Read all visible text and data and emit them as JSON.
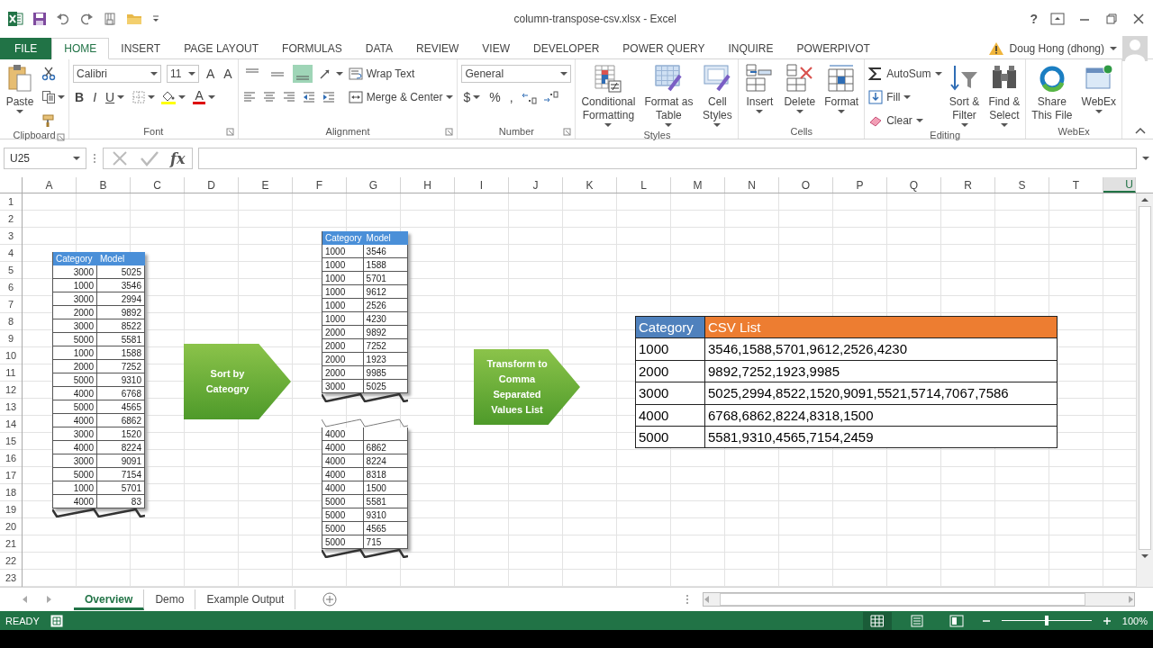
{
  "title_bar": {
    "title": "column-transpose-csv.xlsx - Excel",
    "help": "?"
  },
  "menu_tabs": [
    {
      "label": "FILE",
      "kind": "file",
      "selected": false
    },
    {
      "label": "HOME",
      "kind": "tab",
      "selected": true
    },
    {
      "label": "INSERT",
      "kind": "tab",
      "selected": false
    },
    {
      "label": "PAGE LAYOUT",
      "kind": "tab",
      "selected": false
    },
    {
      "label": "FORMULAS",
      "kind": "tab",
      "selected": false
    },
    {
      "label": "DATA",
      "kind": "tab",
      "selected": false
    },
    {
      "label": "REVIEW",
      "kind": "tab",
      "selected": false
    },
    {
      "label": "VIEW",
      "kind": "tab",
      "selected": false
    },
    {
      "label": "DEVELOPER",
      "kind": "tab",
      "selected": false
    },
    {
      "label": "POWER QUERY",
      "kind": "tab",
      "selected": false
    },
    {
      "label": "INQUIRE",
      "kind": "tab",
      "selected": false
    },
    {
      "label": "POWERPIVOT",
      "kind": "tab",
      "selected": false
    }
  ],
  "user": {
    "name": "Doug Hong (dhong)"
  },
  "ribbon": [
    {
      "label": "Clipboard",
      "launcher": true,
      "sections": [
        {
          "kind": "large",
          "label": "Paste",
          "menu": true
        },
        {
          "kind": "stack",
          "lines": [
            [
              {
                "kind": "icon"
              }
            ],
            [
              {
                "kind": "icon",
                "menu": true
              }
            ],
            [
              {
                "kind": "icon"
              }
            ]
          ]
        }
      ]
    },
    {
      "label": "Font",
      "launcher": true,
      "sections": [
        {
          "kind": "stack",
          "lines": [
            [
              {
                "kind": "combo",
                "value": "Calibri"
              },
              {
                "kind": "combo",
                "value": "11"
              },
              {
                "kind": "glyph",
                "text": "A"
              },
              {
                "kind": "glyph",
                "text": "A"
              }
            ],
            [
              {
                "kind": "glyph",
                "text": "B"
              },
              {
                "kind": "glyph",
                "text": "I"
              },
              {
                "kind": "glyph",
                "text": "U",
                "menu": true
              },
              {
                "kind": "icon",
                "menu": true
              },
              {
                "kind": "icon",
                "menu": true
              },
              {
                "kind": "color-glyph",
                "text": "A",
                "menu": true
              }
            ]
          ]
        }
      ]
    },
    {
      "label": "Alignment",
      "launcher": true,
      "sections": [
        {
          "kind": "stack",
          "lines": [
            [
              {
                "kind": "icon",
                "selected": false
              },
              {
                "kind": "icon",
                "selected": false
              },
              {
                "kind": "icon",
                "selected": true
              },
              {
                "kind": "icon",
                "menu": true
              }
            ],
            [
              {
                "kind": "icon"
              },
              {
                "kind": "icon"
              },
              {
                "kind": "icon"
              },
              {
                "kind": "icon"
              },
              {
                "kind": "icon"
              }
            ]
          ]
        },
        {
          "kind": "stack",
          "lines": [
            [
              {
                "kind": "small",
                "label": "Wrap Text"
              }
            ],
            [
              {
                "kind": "small",
                "label": "Merge & Center",
                "menu": true
              }
            ]
          ]
        }
      ]
    },
    {
      "label": "Number",
      "launcher": true,
      "sections": [
        {
          "kind": "stack",
          "lines": [
            [
              {
                "kind": "combo",
                "value": "General"
              }
            ],
            [
              {
                "kind": "glyph",
                "text": "$",
                "menu": true
              },
              {
                "kind": "glyph",
                "text": "%"
              },
              {
                "kind": "glyph",
                "text": ","
              },
              {
                "kind": "icon"
              },
              {
                "kind": "icon"
              }
            ]
          ]
        }
      ]
    },
    {
      "label": "Styles",
      "launcher": false,
      "sections": [
        {
          "kind": "large",
          "label": "Conditional\nFormatting",
          "menu": true
        },
        {
          "kind": "large",
          "label": "Format as\nTable",
          "menu": true
        },
        {
          "kind": "large",
          "label": "Cell\nStyles",
          "menu": true
        }
      ]
    },
    {
      "label": "Cells",
      "launcher": false,
      "sections": [
        {
          "kind": "large",
          "label": "Insert",
          "menu": true
        },
        {
          "kind": "large",
          "label": "Delete",
          "menu": true
        },
        {
          "kind": "large",
          "label": "Format",
          "menu": true
        }
      ]
    },
    {
      "label": "Editing",
      "launcher": false,
      "sections": [
        {
          "kind": "stack",
          "lines": [
            [
              {
                "kind": "small",
                "label": "AutoSum",
                "menu": true
              }
            ],
            [
              {
                "kind": "small",
                "label": "Fill",
                "menu": true
              }
            ],
            [
              {
                "kind": "small",
                "label": "Clear",
                "menu": true
              }
            ]
          ]
        },
        {
          "kind": "large",
          "label": "Sort &\nFilter",
          "menu": true
        },
        {
          "kind": "large",
          "label": "Find &\nSelect",
          "menu": true
        }
      ]
    },
    {
      "label": "WebEx",
      "launcher": false,
      "sections": [
        {
          "kind": "large",
          "label": "Share\nThis File"
        },
        {
          "kind": "large",
          "label": "WebEx",
          "menu": true
        }
      ]
    }
  ],
  "formula_bar": {
    "name_box": "U25",
    "function_label": "fx"
  },
  "columns": [
    {
      "label": "A",
      "selected": false
    },
    {
      "label": "B",
      "selected": false
    },
    {
      "label": "C",
      "selected": false
    },
    {
      "label": "D",
      "selected": false
    },
    {
      "label": "E",
      "selected": false
    },
    {
      "label": "F",
      "selected": false
    },
    {
      "label": "G",
      "selected": false
    },
    {
      "label": "H",
      "selected": false
    },
    {
      "label": "I",
      "selected": false
    },
    {
      "label": "J",
      "selected": false
    },
    {
      "label": "K",
      "selected": false
    },
    {
      "label": "L",
      "selected": false
    },
    {
      "label": "M",
      "selected": false
    },
    {
      "label": "N",
      "selected": false
    },
    {
      "label": "O",
      "selected": false
    },
    {
      "label": "P",
      "selected": false
    },
    {
      "label": "Q",
      "selected": false
    },
    {
      "label": "R",
      "selected": false
    },
    {
      "label": "S",
      "selected": false
    },
    {
      "label": "T",
      "selected": false
    },
    {
      "label": "U",
      "selected": true
    }
  ],
  "rows": [
    "1",
    "2",
    "3",
    "4",
    "5",
    "6",
    "7",
    "8",
    "9",
    "10",
    "11",
    "12",
    "13",
    "14",
    "15",
    "16",
    "17",
    "18",
    "19",
    "20",
    "21",
    "22",
    "23"
  ],
  "objects": [
    {
      "kind": "table",
      "torn_top": false,
      "torn_bottom": true,
      "header": [
        "Category",
        "Model"
      ],
      "rows": [
        [
          "3000",
          "5025"
        ],
        [
          "1000",
          "3546"
        ],
        [
          "3000",
          "2994"
        ],
        [
          "2000",
          "9892"
        ],
        [
          "3000",
          "8522"
        ],
        [
          "5000",
          "5581"
        ],
        [
          "1000",
          "1588"
        ],
        [
          "2000",
          "7252"
        ],
        [
          "5000",
          "9310"
        ],
        [
          "4000",
          "6768"
        ],
        [
          "5000",
          "4565"
        ],
        [
          "4000",
          "6862"
        ],
        [
          "3000",
          "1520"
        ],
        [
          "4000",
          "8224"
        ],
        [
          "3000",
          "9091"
        ],
        [
          "5000",
          "7154"
        ],
        [
          "1000",
          "5701"
        ],
        [
          "4000",
          "83"
        ]
      ]
    },
    {
      "kind": "arrow",
      "text": "Sort by\nCateogry"
    },
    {
      "kind": "sorted-table",
      "torn_top": false,
      "torn_bottom": true,
      "header": [
        "Category",
        "Model"
      ],
      "rows": [
        [
          "1000",
          "3546"
        ],
        [
          "1000",
          "1588"
        ],
        [
          "1000",
          "5701"
        ],
        [
          "1000",
          "9612"
        ],
        [
          "1000",
          "2526"
        ],
        [
          "1000",
          "4230"
        ],
        [
          "2000",
          "9892"
        ],
        [
          "2000",
          "7252"
        ],
        [
          "2000",
          "1923"
        ],
        [
          "2000",
          "9985"
        ],
        [
          "3000",
          "5025"
        ]
      ]
    },
    {
      "kind": "sorted-table",
      "torn_top": true,
      "torn_bottom": true,
      "rows": [
        [
          "4000"
        ],
        [
          "4000",
          "6862"
        ],
        [
          "4000",
          "8224"
        ],
        [
          "4000",
          "8318"
        ],
        [
          "4000",
          "1500"
        ],
        [
          "5000",
          "5581"
        ],
        [
          "5000",
          "9310"
        ],
        [
          "5000",
          "4565"
        ],
        [
          "5000",
          "715"
        ]
      ]
    },
    {
      "kind": "arrow",
      "text": "Transform to\nComma\nSeparated\nValues List"
    },
    {
      "kind": "csv-table",
      "header": [
        {
          "text": "Category",
          "color": "#4f81bd"
        },
        {
          "text": "CSV List",
          "color": "#ed7d31"
        }
      ],
      "rows": [
        [
          "1000",
          "3546,1588,5701,9612,2526,4230"
        ],
        [
          "2000",
          "9892,7252,1923,9985"
        ],
        [
          "3000",
          "5025,2994,8522,1520,9091,5521,5714,7067,7586"
        ],
        [
          "4000",
          "6768,6862,8224,8318,1500"
        ],
        [
          "5000",
          "5581,9310,4565,7154,2459"
        ]
      ]
    }
  ],
  "sheet_tabs": [
    {
      "label": "Overview",
      "selected": true
    },
    {
      "label": "Demo",
      "selected": false
    },
    {
      "label": "Example Output",
      "selected": false
    }
  ],
  "status_bar": {
    "mode": "READY",
    "views": [
      {
        "selected": true
      },
      {
        "selected": false
      },
      {
        "selected": false
      }
    ],
    "zoom_slider": {
      "level": 0.5
    },
    "zoom": "100%"
  }
}
